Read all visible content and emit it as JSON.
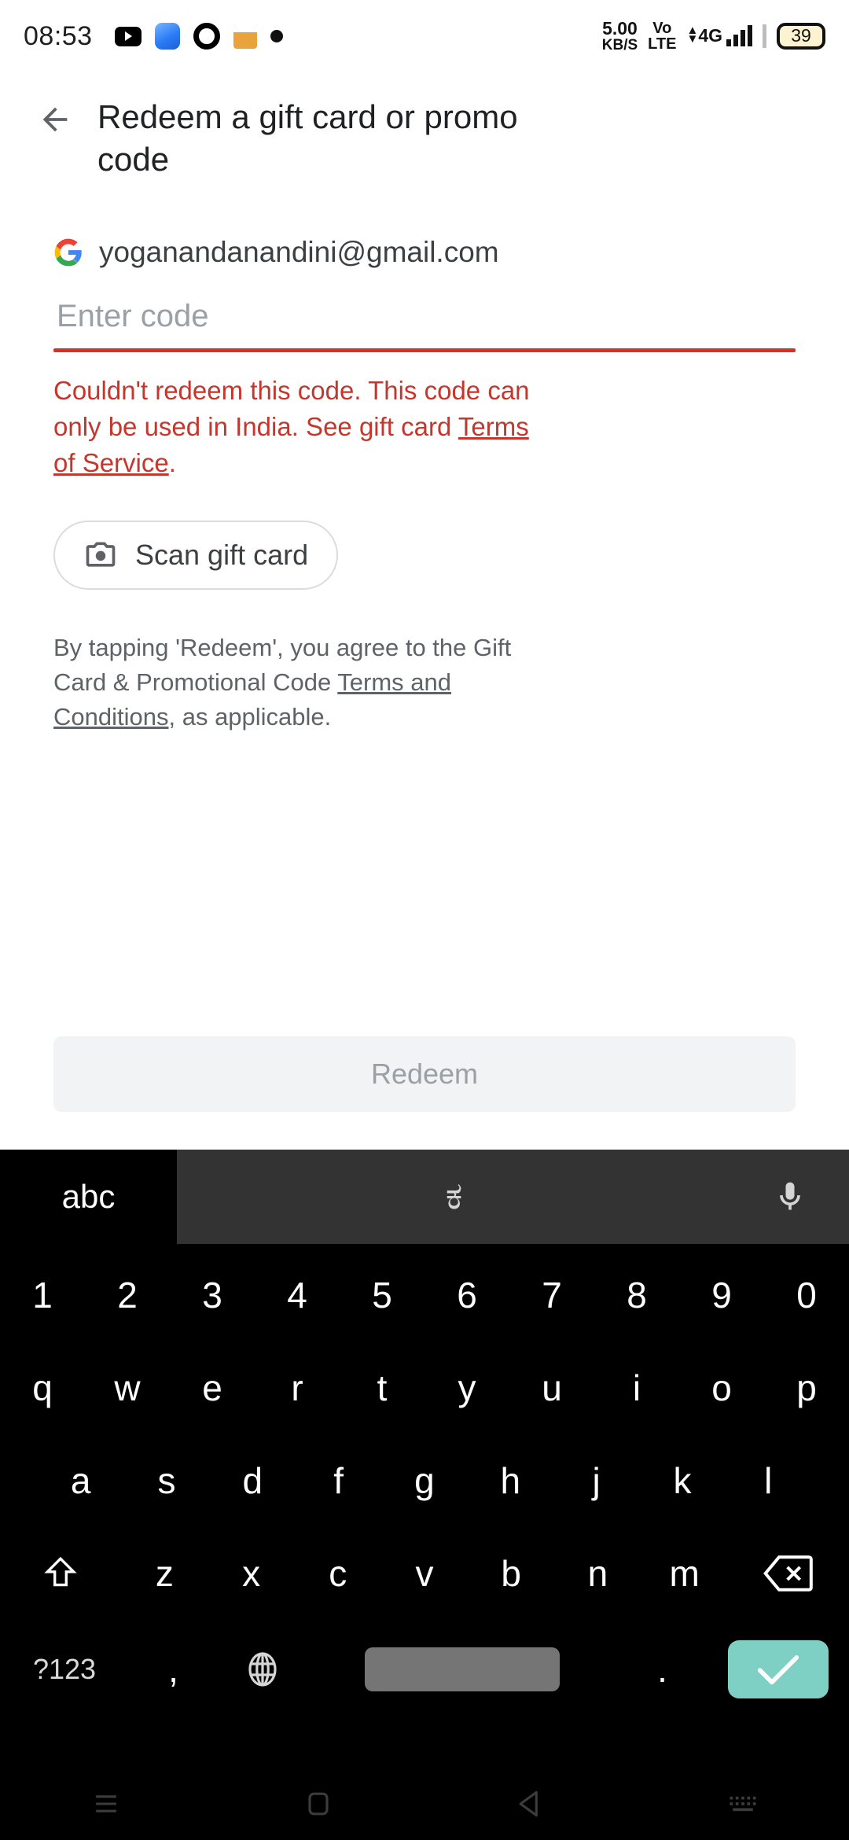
{
  "status_bar": {
    "time": "08:53",
    "left_icons": [
      "youtube-icon",
      "messenger-icon",
      "ring-icon",
      "calendar-icon",
      "dot-icon"
    ],
    "net_speed_value": "5.00",
    "net_speed_unit": "KB/S",
    "volte_line1": "Vo",
    "volte_line2": "LTE",
    "network_type": "4G",
    "battery_level": "39"
  },
  "appbar": {
    "back_icon": "back-arrow-icon",
    "title": "Redeem a gift card or promo code"
  },
  "account": {
    "provider_icon": "google-g-icon",
    "email": "yoganandanandini@gmail.com"
  },
  "code_field": {
    "placeholder": "Enter code",
    "value": "",
    "underline_color": "#d93025"
  },
  "error": {
    "text_before_link": "Couldn't redeem this code. This code can only be used in India. See gift card ",
    "link_text": "Terms of Service",
    "text_after_link": ".",
    "color": "#c5362c"
  },
  "scan_button": {
    "icon": "camera-icon",
    "label": "Scan gift card"
  },
  "legal": {
    "text_before_link": "By tapping 'Redeem', you agree to the Gift Card & Promotional Code ",
    "link_text": "Terms and Conditions",
    "text_after_link": ", as applicable."
  },
  "redeem_button": {
    "label": "Redeem",
    "enabled": false,
    "bg_color": "#f1f3f4",
    "text_color": "#9aa0a6"
  },
  "keyboard": {
    "toolbar": {
      "abc_label": "abc",
      "language_label": "ಕ",
      "mic_icon": "microphone-icon"
    },
    "row_numbers": [
      "1",
      "2",
      "3",
      "4",
      "5",
      "6",
      "7",
      "8",
      "9",
      "0"
    ],
    "row_top": [
      "q",
      "w",
      "e",
      "r",
      "t",
      "y",
      "u",
      "i",
      "o",
      "p"
    ],
    "row_home": [
      "a",
      "s",
      "d",
      "f",
      "g",
      "h",
      "j",
      "k",
      "l"
    ],
    "row_bottom_letters": [
      "z",
      "x",
      "c",
      "v",
      "b",
      "n",
      "m"
    ],
    "shift_icon": "shift-up-icon",
    "backspace_icon": "backspace-icon",
    "symbols_key": "?123",
    "comma_key": ",",
    "globe_icon": "globe-icon",
    "space_key": "",
    "period_key": ".",
    "enter_icon": "check-icon",
    "enter_key_color": "#7ecfc4"
  },
  "nav_bar": {
    "recents_icon": "recents-icon",
    "home_icon": "home-square-icon",
    "back_icon": "nav-back-triangle-icon",
    "keyboard_icon": "keyboard-icon"
  }
}
